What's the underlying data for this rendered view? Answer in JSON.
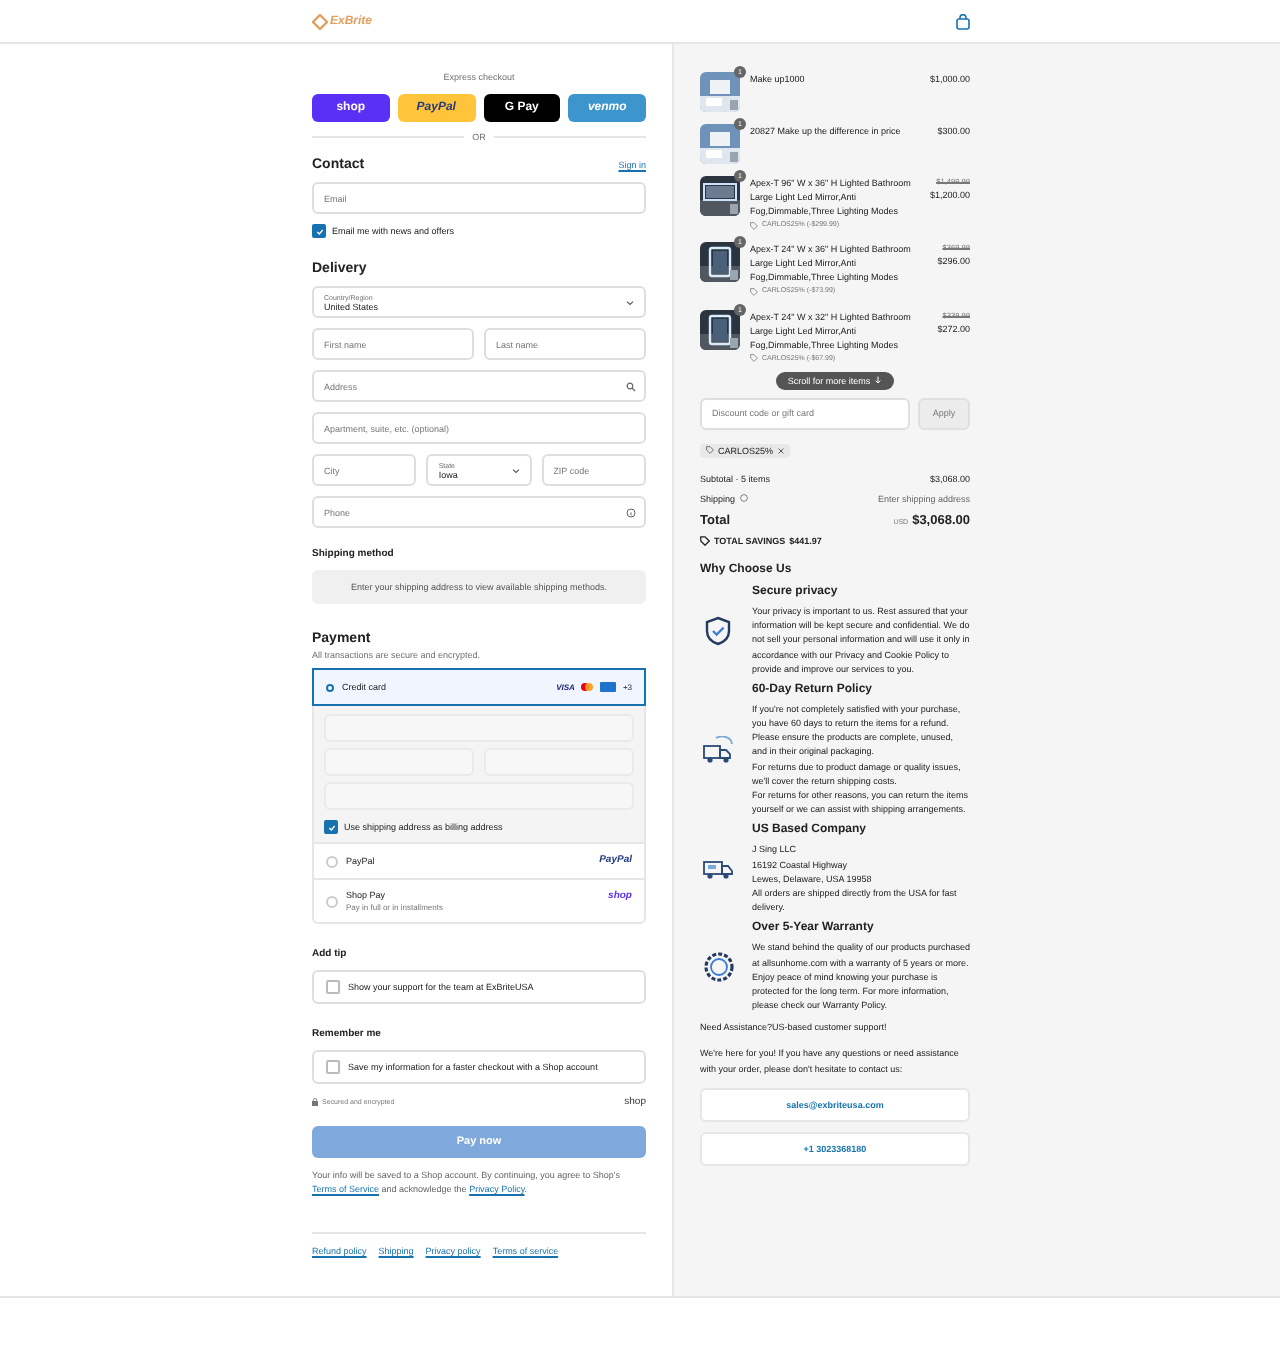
{
  "header": {
    "logo": "ExBrite"
  },
  "express": {
    "label": "Express checkout",
    "buttons": [
      {
        "kind": "shop",
        "label": "shop"
      },
      {
        "kind": "paypal",
        "label": "PayPal"
      },
      {
        "kind": "gpay",
        "label": "G Pay"
      },
      {
        "kind": "venmo",
        "label": "venmo"
      }
    ],
    "or": "OR"
  },
  "contact": {
    "title": "Contact",
    "sign_in": "Sign in",
    "email": {
      "placeholder": "Email"
    },
    "news": {
      "label": "Email me with news and offers",
      "checked": true
    }
  },
  "delivery": {
    "title": "Delivery",
    "country": {
      "label": "Country/Region",
      "value": "United States"
    },
    "first_name": {
      "placeholder": "First name"
    },
    "last_name": {
      "placeholder": "Last name"
    },
    "address": {
      "placeholder": "Address"
    },
    "apartment": {
      "placeholder": "Apartment, suite, etc. (optional)"
    },
    "city": {
      "placeholder": "City"
    },
    "state": {
      "label": "State",
      "value": "Iowa"
    },
    "zip": {
      "placeholder": "ZIP code"
    },
    "phone": {
      "placeholder": "Phone"
    }
  },
  "shipping_method": {
    "title": "Shipping method",
    "note": "Enter your shipping address to view available shipping methods."
  },
  "payment": {
    "title": "Payment",
    "subtitle": "All transactions are secure and encrypted.",
    "options": [
      {
        "kind": "card",
        "label": "Credit card",
        "selected": true,
        "brands": "VISA",
        "more": "+3",
        "billing": {
          "label": "Use shipping address as billing address",
          "checked": true
        }
      },
      {
        "kind": "paypal",
        "label": "PayPal",
        "selected": false,
        "logo": "PayPal"
      },
      {
        "kind": "shop",
        "label": "Shop Pay",
        "sublabel": "Pay in full or in installments",
        "selected": false,
        "logo": "shop"
      }
    ]
  },
  "tip": {
    "title": "Add tip",
    "label": "Show your support for the team at ExBriteUSA",
    "checked": false
  },
  "remember": {
    "title": "Remember me",
    "label": "Save my information for a faster checkout with a Shop account",
    "checked": false,
    "secure": "Secured and encrypted",
    "logo": "shop"
  },
  "pay_button": "Pay now",
  "consent": [
    {
      "kind": "text",
      "text": "Your info will be saved to a Shop account. By continuing, you agree to Shop's "
    },
    {
      "kind": "link",
      "text": "Terms of Service"
    },
    {
      "kind": "text",
      "text": " and acknowledge the "
    },
    {
      "kind": "link",
      "text": "Privacy Policy"
    },
    {
      "kind": "text",
      "text": "."
    }
  ],
  "footer_links": [
    "Refund policy",
    "Shipping",
    "Privacy policy",
    "Terms of service"
  ],
  "cart": {
    "items": [
      {
        "qty": "1",
        "name": "Make up1000",
        "price": "$1,000.00"
      },
      {
        "qty": "1",
        "name": "20827 Make up the difference in price",
        "price": "$300.00"
      },
      {
        "qty": "1",
        "name": "Apex-T 96\" W x 36\" H Lighted Bathroom Large Light Led Mirror,Anti Fog,Dimmable,Three Lighting Modes",
        "original_price": "$1,499.99",
        "price": "$1,200.00",
        "discount": "CARLOS25% (-$299.99)"
      },
      {
        "qty": "1",
        "name": "Apex-T 24\" W x 36\" H Lighted Bathroom Large Light Led Mirror,Anti Fog,Dimmable,Three Lighting Modes",
        "original_price": "$369.99",
        "price": "$296.00",
        "discount": "CARLOS25% (-$73.99)"
      },
      {
        "qty": "1",
        "name": "Apex-T 24\" W x 32\" H Lighted Bathroom Large Light Led Mirror,Anti Fog,Dimmable,Three Lighting Modes",
        "original_price": "$339.99",
        "price": "$272.00",
        "discount": "CARLOS25% (-$67.99)"
      }
    ],
    "scroll_hint": "Scroll for more items",
    "discount_field": {
      "placeholder": "Discount code or gift card"
    },
    "apply": "Apply",
    "code": "CARLOS25%",
    "subtotal_label": "Subtotal · 5 items",
    "subtotal": "$3,068.00",
    "shipping_label": "Shipping",
    "shipping_value": "Enter shipping address",
    "total_label": "Total",
    "currency": "USD",
    "total": "$3,068.00",
    "savings_label": "TOTAL SAVINGS",
    "savings": "$441.97"
  },
  "why": {
    "title": "Why Choose Us",
    "features": [
      {
        "title": "Secure privacy",
        "paragraphs": [
          "Your privacy is important to us. Rest assured that your information will be kept secure and confidential. We do not sell your personal information and will use it only in accordance with our Privacy and Cookie Policy to provide and improve our services to you."
        ]
      },
      {
        "title": "60-Day Return Policy",
        "paragraphs": [
          "If you're not completely satisfied with your purchase, you have 60 days to return the items for a refund.",
          "Please ensure the products are complete, unused, and in their original packaging.",
          "For returns due to product damage or quality issues, we'll cover the return shipping costs.",
          "For returns for other reasons, you can return the items yourself or we can assist with shipping arrangements."
        ]
      },
      {
        "title": "US Based Company",
        "paragraphs": [
          "J Sing LLC",
          "16192 Coastal Highway",
          "Lewes, Delaware, USA 19958",
          "All orders are shipped directly from the USA for fast delivery."
        ]
      },
      {
        "title": "Over 5-Year Warranty",
        "paragraphs": [
          "We stand behind the quality of our products purchased at allsunhome.com with a warranty of 5 years or more. Enjoy peace of mind knowing your purchase is protected for the long term. For more information, please check our Warranty Policy."
        ]
      }
    ],
    "assist_title": "Need Assistance?US-based customer support!",
    "assist_text": "We're here for you! If you have any questions or need assistance with your order, please don't hesitate to contact us:",
    "email": "sales@exbriteusa.com",
    "phone": "+1 3023368180"
  }
}
